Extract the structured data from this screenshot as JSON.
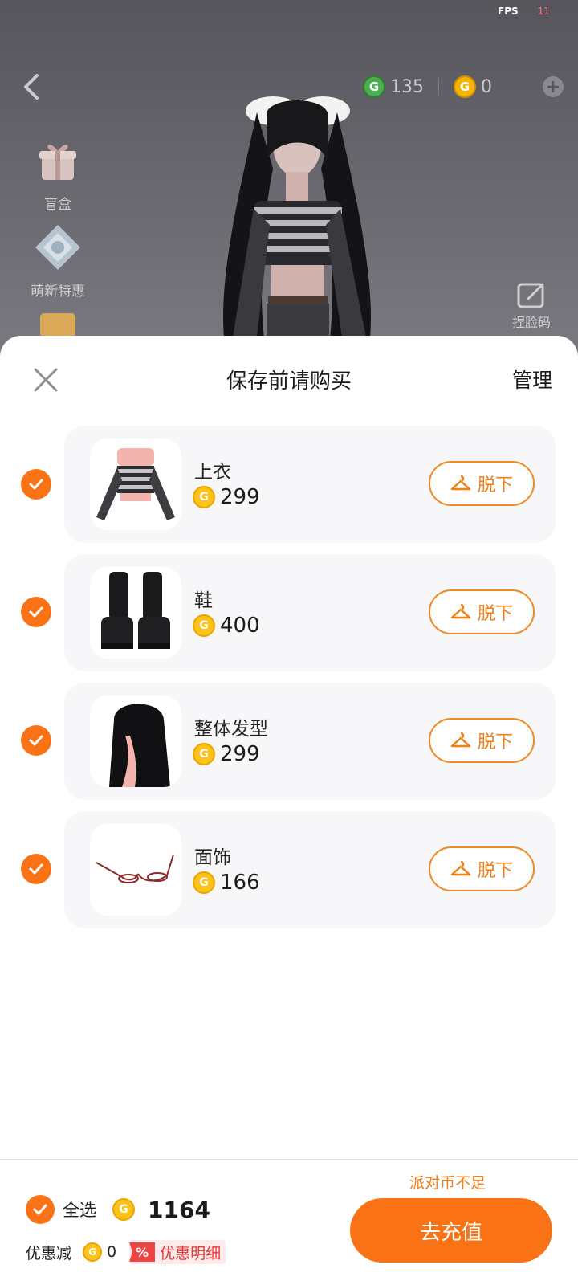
{
  "status": {
    "fps_label": "FPS",
    "fps_value": "11"
  },
  "header": {
    "coins_green": "135",
    "coins_gold": "0"
  },
  "sidebar": {
    "blind_box": "盲盒",
    "newbie_deal": "萌新特惠",
    "face_code": "捏脸码"
  },
  "sheet": {
    "title": "保存前请购买",
    "manage": "管理",
    "take_off_label": "脱下"
  },
  "items": [
    {
      "name": "上衣",
      "price": "299"
    },
    {
      "name": "鞋",
      "price": "400"
    },
    {
      "name": "整体发型",
      "price": "299"
    },
    {
      "name": "面饰",
      "price": "166"
    }
  ],
  "footer": {
    "select_all": "全选",
    "total": "1164",
    "discount_label": "优惠减",
    "discount_value": "0",
    "discount_pct": "%",
    "discount_detail": "优惠明细",
    "insufficient": "派对币不足",
    "recharge": "去充值"
  },
  "colors": {
    "accent": "#f97316",
    "coin": "#fcc21a",
    "discount": "#e53935"
  }
}
